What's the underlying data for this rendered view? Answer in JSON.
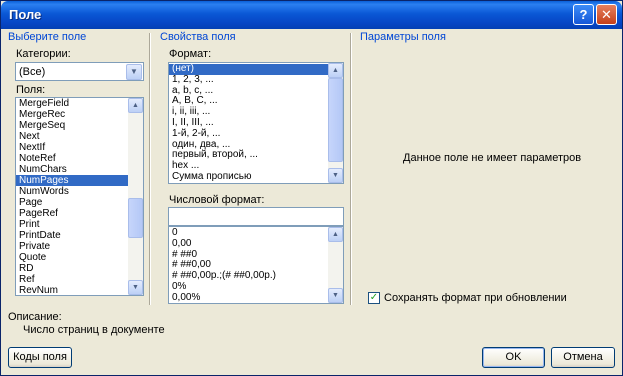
{
  "window": {
    "title": "Поле",
    "help_label": "?",
    "close_label": "✕"
  },
  "left": {
    "section_title": "Выберите поле",
    "categories_label": "Категории:",
    "categories_value": "(Все)",
    "fields_label": "Поля:",
    "fields": [
      "MergeField",
      "MergeRec",
      "MergeSeq",
      "Next",
      "NextIf",
      "NoteRef",
      "NumChars",
      "NumPages",
      "NumWords",
      "Page",
      "PageRef",
      "Print",
      "PrintDate",
      "Private",
      "Quote",
      "RD",
      "Ref",
      "RevNum"
    ],
    "selected_field": "NumPages"
  },
  "middle": {
    "section_title": "Свойства поля",
    "format_label": "Формат:",
    "formats": [
      "(нет)",
      "1, 2, 3, ...",
      "a, b, c, ...",
      "A, B, C, ...",
      "i, ii, iii, ...",
      "I, II, III, ...",
      "1-й, 2-й, ...",
      "один, два, ...",
      "первый, второй, ...",
      "hex ...",
      "Сумма прописью"
    ],
    "selected_format": "(нет)",
    "number_format_label": "Числовой формат:",
    "number_format_value": "",
    "number_formats": [
      "0",
      "0,00",
      "# ##0",
      "# ##0,00",
      "# ##0,00р.;(# ##0,00р.)",
      "0%",
      "0,00%"
    ]
  },
  "right": {
    "section_title": "Параметры поля",
    "no_params_text": "Данное поле не имеет параметров",
    "preserve_format_label": "Сохранять формат при обновлении",
    "preserve_format_checked": true
  },
  "description": {
    "label": "Описание:",
    "text": "Число страниц в документе"
  },
  "buttons": {
    "field_codes": "Коды поля",
    "ok": "OK",
    "cancel": "Отмена"
  },
  "icons": {
    "combo_arrow": "chevron-down-icon",
    "scroll_up": "scroll-up-icon",
    "scroll_down": "scroll-down-icon",
    "check": "check-icon"
  },
  "colors": {
    "title_bar": "#0a58d6",
    "section_title": "#0046d5",
    "selection": "#316ac5",
    "dialog_bg": "#ece9d8"
  }
}
